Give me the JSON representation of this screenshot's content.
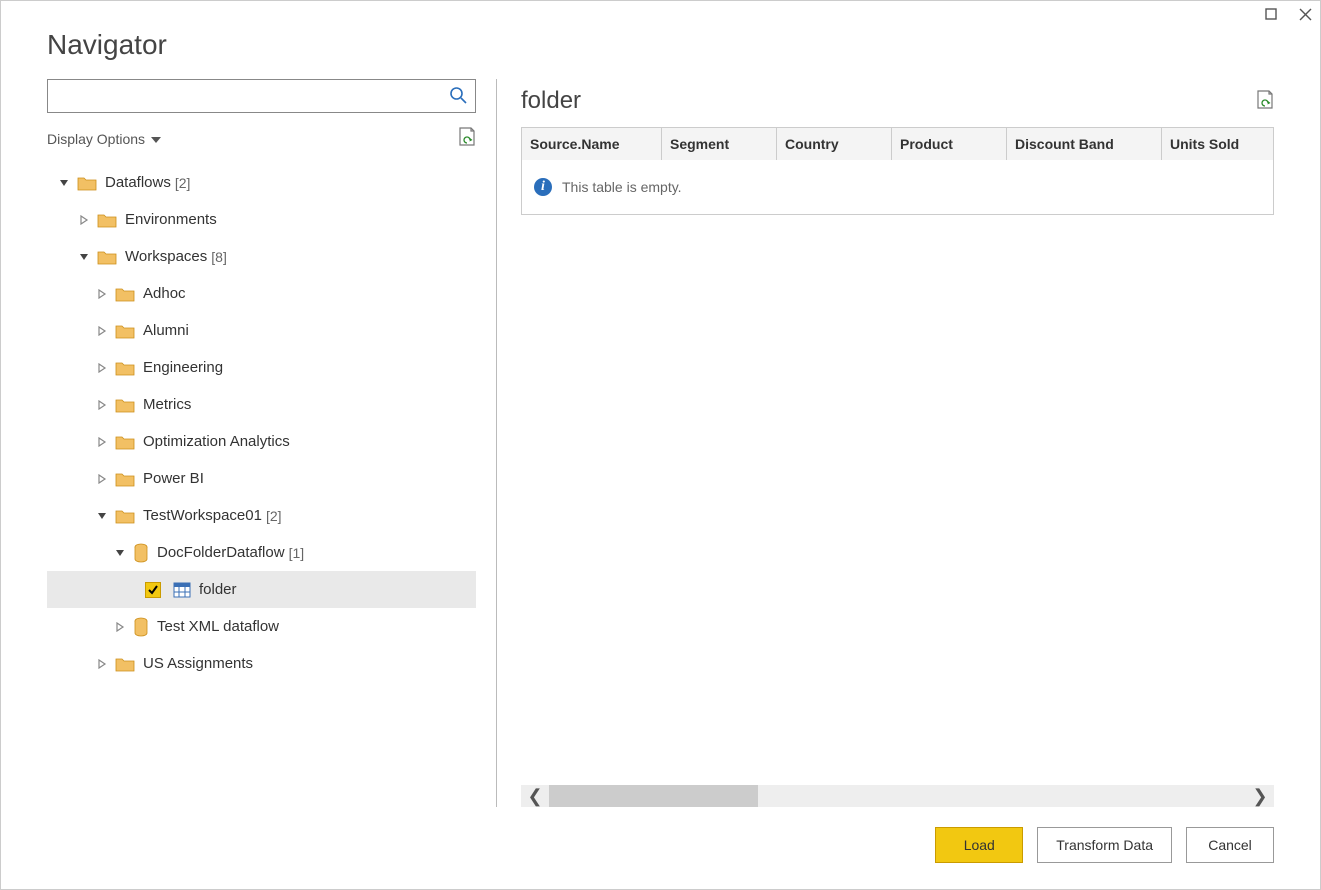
{
  "window": {
    "title": "Navigator"
  },
  "search": {
    "placeholder": ""
  },
  "displayOptions": {
    "label": "Display Options"
  },
  "tree": {
    "root": {
      "label": "Dataflows",
      "count": "[2]",
      "children": {
        "env": {
          "label": "Environments"
        },
        "workspaces": {
          "label": "Workspaces",
          "count": "[8]",
          "children": {
            "adhoc": {
              "label": "Adhoc"
            },
            "alumni": {
              "label": "Alumni"
            },
            "engineering": {
              "label": "Engineering"
            },
            "metrics": {
              "label": "Metrics"
            },
            "optanalytics": {
              "label": "Optimization Analytics"
            },
            "powerbi": {
              "label": "Power BI"
            },
            "testws": {
              "label": "TestWorkspace01",
              "count": "[2]",
              "children": {
                "docfolder": {
                  "label": "DocFolderDataflow",
                  "count": "[1]",
                  "children": {
                    "folder": {
                      "label": "folder"
                    }
                  }
                },
                "testxml": {
                  "label": "Test XML dataflow"
                }
              }
            },
            "usassign": {
              "label": "US Assignments"
            }
          }
        }
      }
    }
  },
  "preview": {
    "title": "folder",
    "columns": {
      "c0": "Source.Name",
      "c1": "Segment",
      "c2": "Country",
      "c3": "Product",
      "c4": "Discount Band",
      "c5": "Units Sold"
    },
    "emptyMessage": "This table is empty."
  },
  "buttons": {
    "load": "Load",
    "transform": "Transform Data",
    "cancel": "Cancel"
  }
}
